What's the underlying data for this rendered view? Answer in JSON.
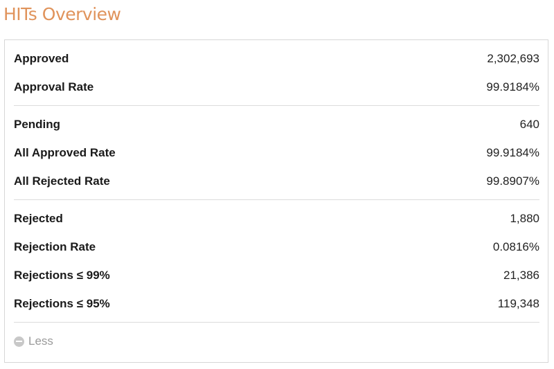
{
  "title": "HITs Overview",
  "groups": [
    {
      "rows": [
        {
          "label": "Approved",
          "value": "2,302,693"
        },
        {
          "label": "Approval Rate",
          "value": "99.9184%"
        }
      ]
    },
    {
      "rows": [
        {
          "label": "Pending",
          "value": "640"
        },
        {
          "label": "All Approved Rate",
          "value": "99.9184%"
        },
        {
          "label": "All Rejected Rate",
          "value": "99.8907%"
        }
      ]
    },
    {
      "rows": [
        {
          "label": "Rejected",
          "value": "1,880"
        },
        {
          "label": "Rejection Rate",
          "value": "0.0816%"
        },
        {
          "label": "Rejections ≤ 99%",
          "value": "21,386"
        },
        {
          "label": "Rejections ≤ 95%",
          "value": "119,348"
        }
      ]
    }
  ],
  "toggle": {
    "icon": "minus-circle-icon",
    "label": "Less"
  },
  "colors": {
    "title": "#e0935b",
    "border": "#d6d6d6",
    "toggle_text": "#9a9a9a"
  }
}
